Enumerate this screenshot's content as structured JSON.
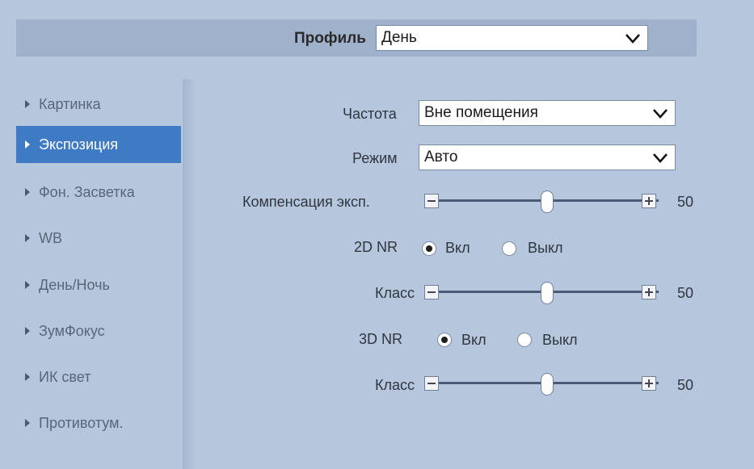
{
  "profile": {
    "label": "Профиль",
    "value": "День"
  },
  "sidebar": {
    "items": [
      {
        "label": "Картинка",
        "active": false
      },
      {
        "label": "Экспозиция",
        "active": true
      },
      {
        "label": "Фон. Засветка",
        "active": false
      },
      {
        "label": "WB",
        "active": false
      },
      {
        "label": "День/Ночь",
        "active": false
      },
      {
        "label": "ЗумФокус",
        "active": false
      },
      {
        "label": "ИК свет",
        "active": false
      },
      {
        "label": "Противотум.",
        "active": false
      }
    ]
  },
  "settings": {
    "frequency": {
      "label": "Частота",
      "value": "Вне помещения"
    },
    "mode": {
      "label": "Режим",
      "value": "Авто"
    },
    "exposure_comp": {
      "label": "Компенсация эксп.",
      "value": "50"
    },
    "nr2d": {
      "label": "2D NR",
      "on_label": "Вкл",
      "off_label": "Выкл",
      "selected": "on"
    },
    "nr2d_level": {
      "label": "Класс",
      "value": "50"
    },
    "nr3d": {
      "label": "3D NR",
      "on_label": "Вкл",
      "off_label": "Выкл",
      "selected": "on"
    },
    "nr3d_level": {
      "label": "Класс",
      "value": "50"
    }
  },
  "colors": {
    "background": "#b6c6dd",
    "active_item": "#3f7bc4",
    "profile_bar": "#9fb1cb"
  }
}
